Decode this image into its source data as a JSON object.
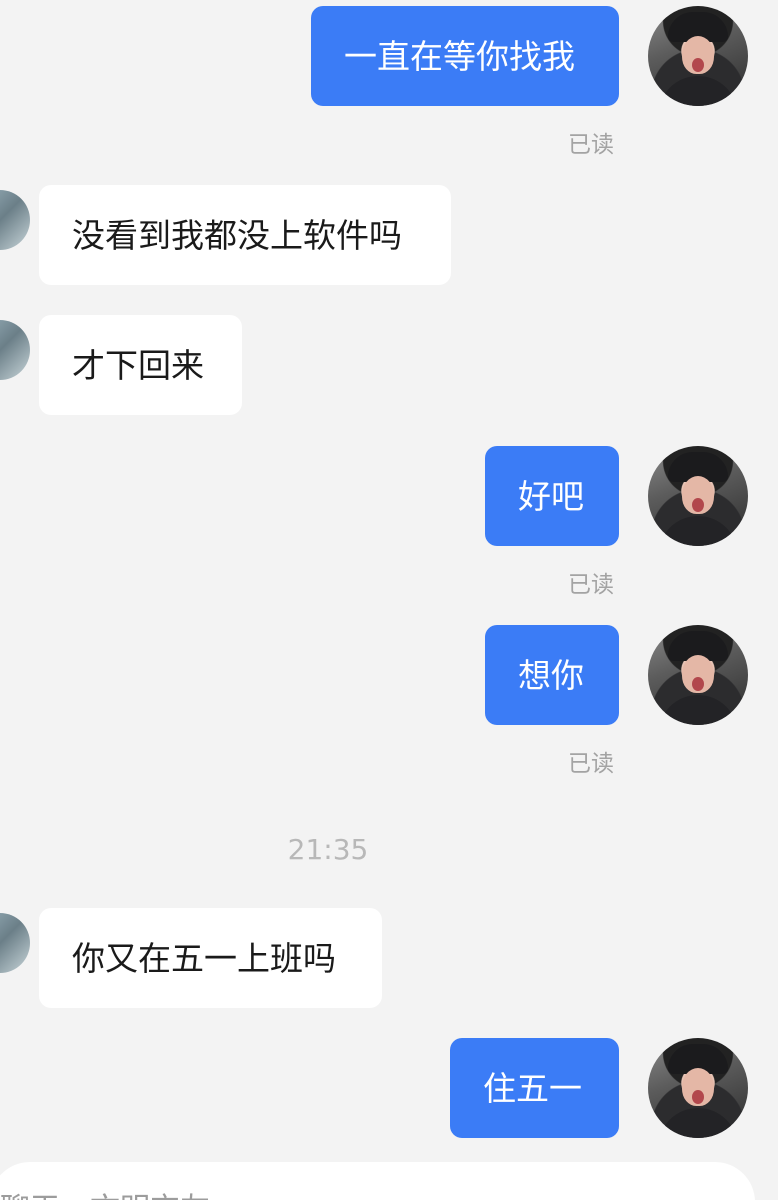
{
  "chat": {
    "messages": [
      {
        "text": "一直在等你找我",
        "status": "已读"
      },
      {
        "text": "没看到我都没上软件吗"
      },
      {
        "text": "才下回来"
      },
      {
        "text": "好吧",
        "status": "已读"
      },
      {
        "text": "想你",
        "status": "已读"
      },
      {
        "text": "你又在五一上班吗"
      },
      {
        "text": "住五一"
      }
    ],
    "time_divider": "21:35"
  },
  "input": {
    "placeholder": "聊天，文明交友"
  },
  "colors": {
    "outgoing_bubble": "#3b7cf6",
    "incoming_bubble": "#ffffff",
    "background": "#f3f3f3"
  }
}
